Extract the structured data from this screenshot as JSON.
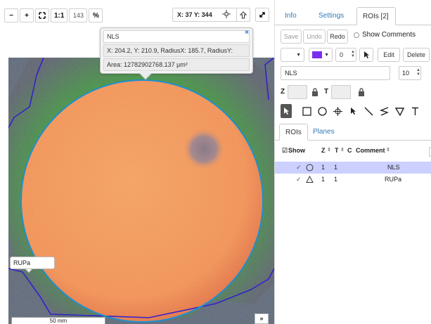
{
  "viewer": {
    "toolbar": {
      "zoom_out": "−",
      "zoom_in": "+",
      "fit": "⛶",
      "one_to_one": "1:1",
      "zoom_value": "143",
      "percent": "%"
    },
    "coords": "X: 37 Y: 344",
    "popup": {
      "name": "NLS",
      "info": "X: 204.2, Y: 210.9, RadiusX: 185.7, RadiusY:",
      "area": "Area: 12782902768.137 µm²",
      "close": "×"
    },
    "rupa_label": "RUPa",
    "scalebar": "50 mm",
    "expand": "»"
  },
  "panel": {
    "tabs": [
      {
        "label": "Info",
        "active": false
      },
      {
        "label": "Settings",
        "active": false
      },
      {
        "label": "ROIs [2]",
        "active": true
      }
    ],
    "buttons": {
      "save": "Save",
      "undo": "Undo",
      "redo": "Redo",
      "show_comments": "Show Comments",
      "edit": "Edit",
      "delete": "Delete"
    },
    "stroke_width": "0",
    "name_input": "NLS",
    "font_size": "10",
    "z_label": "Z",
    "t_label": "T",
    "subtabs": [
      {
        "label": "ROIs",
        "active": true
      },
      {
        "label": "Planes",
        "active": false
      }
    ],
    "table": {
      "headers": {
        "show": "Show",
        "z": "Z",
        "t": "T",
        "c": "C",
        "comment": "Comment"
      },
      "rows": [
        {
          "z": "1",
          "t": "1",
          "comment": "NLS",
          "shape": "ellipse",
          "selected": true
        },
        {
          "z": "1",
          "t": "1",
          "comment": "RUPa",
          "shape": "polygon",
          "selected": false
        }
      ]
    }
  },
  "colors": {
    "accent": "#337ab7",
    "selection_row": "#ccd0ff",
    "ellipse_stroke": "#1e8fd0",
    "polygon_stroke": "#3322cc",
    "fill_swatch": "#7a2cf0"
  }
}
